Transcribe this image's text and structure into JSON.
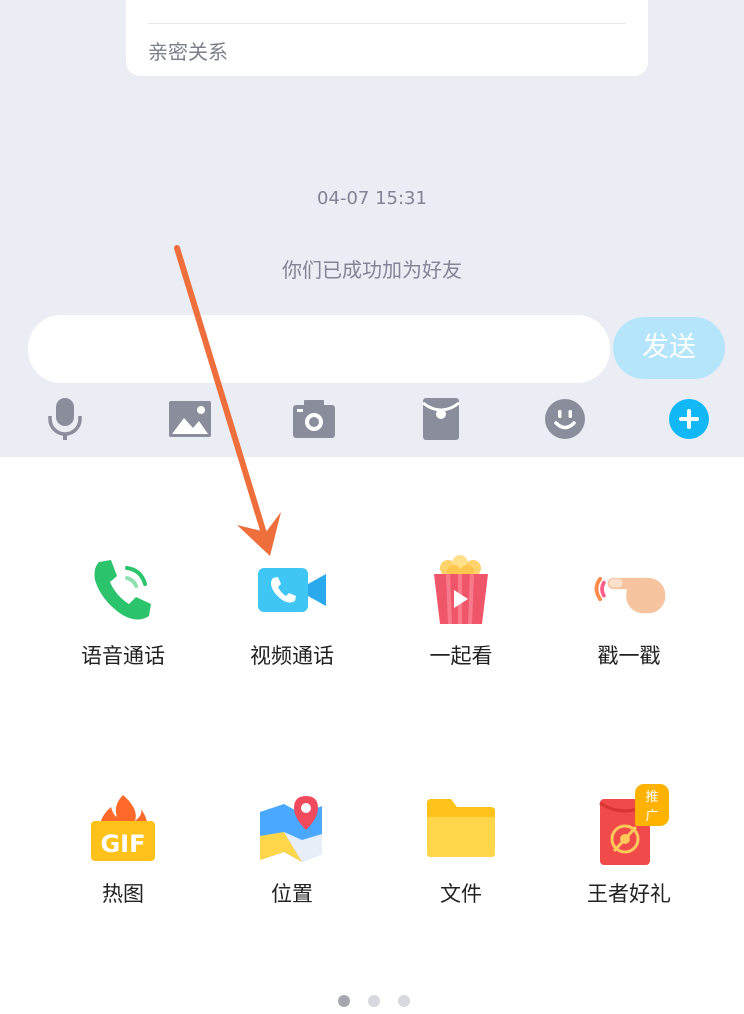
{
  "relation_card": {
    "label": "亲密关系"
  },
  "chat": {
    "timestamp": "04-07 15:31",
    "system_message": "你们已成功加为好友"
  },
  "input": {
    "value": "",
    "placeholder": ""
  },
  "send_button": {
    "label": "发送"
  },
  "toolbar": {
    "icons": [
      "microphone-icon",
      "image-icon",
      "camera-icon",
      "red-packet-icon",
      "emoji-icon",
      "plus-icon"
    ]
  },
  "panel": {
    "features": [
      {
        "label": "语音通话",
        "icon": "phone-icon"
      },
      {
        "label": "视频通话",
        "icon": "video-call-icon"
      },
      {
        "label": "一起看",
        "icon": "popcorn-icon"
      },
      {
        "label": "戳一戳",
        "icon": "poke-hand-icon"
      },
      {
        "label": "热图",
        "icon": "gif-icon"
      },
      {
        "label": "位置",
        "icon": "map-pin-icon"
      },
      {
        "label": "文件",
        "icon": "folder-icon"
      },
      {
        "label": "王者好礼",
        "icon": "gift-packet-icon",
        "badge": "推广"
      }
    ],
    "pager": {
      "pages": 3,
      "current": 1
    }
  },
  "colors": {
    "chat_background": "#ebedf5",
    "send_button": "#b5e5fb",
    "accent_blue": "#12b7f5",
    "annotation_arrow": "#ee6e3c"
  }
}
